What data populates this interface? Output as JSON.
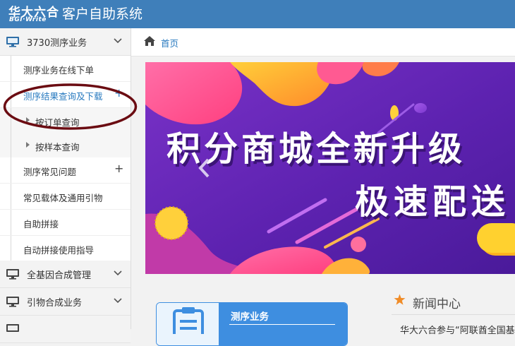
{
  "header": {
    "logo_cn": "华大六合",
    "logo_en": "BGI·Write",
    "app_title": "客户自助系统"
  },
  "sidebar": {
    "group_sequencing": {
      "label": "3730测序业务",
      "icon": "monitor-icon",
      "expanded": true
    },
    "items": [
      {
        "label": "测序业务在线下单",
        "has_plus": false
      },
      {
        "label": "测序结果查询及下载",
        "has_plus": true,
        "active": true
      },
      {
        "label": "测序常见问题",
        "has_plus": true
      },
      {
        "label": "常见载体及通用引物",
        "has_plus": false
      },
      {
        "label": "自助拼接",
        "has_plus": false
      },
      {
        "label": "自动拼接使用指导",
        "has_plus": false
      }
    ],
    "subitems": [
      {
        "label": "按订单查询"
      },
      {
        "label": "按样本查询"
      }
    ],
    "plus_symbol": "+",
    "group_gene": {
      "label": "全基因合成管理",
      "icon": "monitor-icon",
      "expanded": false
    },
    "group_primer": {
      "label": "引物合成业务",
      "icon": "monitor-icon",
      "expanded": false
    }
  },
  "breadcrumb": {
    "icon": "home-icon",
    "label": "首页"
  },
  "banner": {
    "line1": "积分商城全新升级",
    "line2": "极速配送",
    "prev_icon": "chevron-left-icon"
  },
  "card": {
    "title": "测序业务",
    "icon": "clipboard-icon"
  },
  "news": {
    "title": "新闻中心",
    "icon": "star-icon",
    "snippet": "华大六合参与“阿联酋全国基"
  },
  "colors": {
    "header_bg": "#3f7fba",
    "accent_blue": "#2a7bc0",
    "card_blue": "#3e8ee0",
    "star_orange": "#f08c28",
    "annotation_ring": "#6b0c12"
  }
}
